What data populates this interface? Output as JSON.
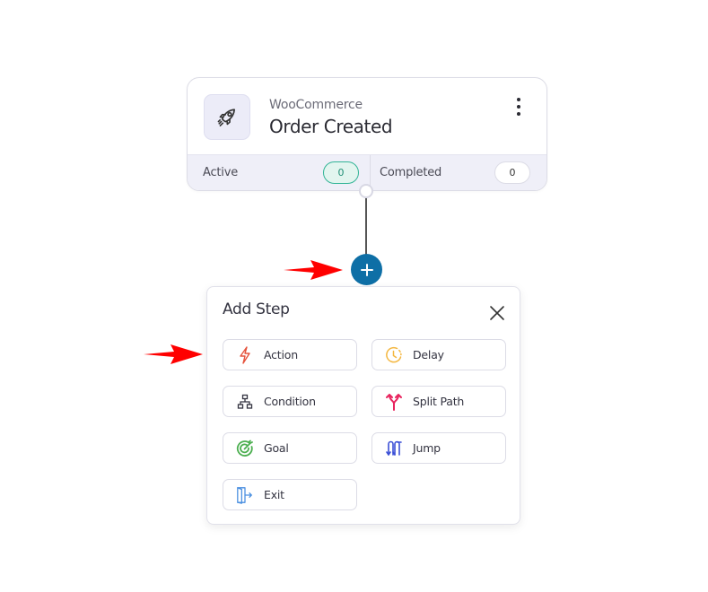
{
  "trigger": {
    "icon": "rocket-icon",
    "subtitle": "WooCommerce",
    "title": "Order Created",
    "menu_icon": "kebab-menu-icon",
    "stats": [
      {
        "label": "Active",
        "value": "0",
        "color": "#32b496"
      },
      {
        "label": "Completed",
        "value": "0"
      }
    ]
  },
  "add_button": {
    "icon": "plus-icon",
    "color": "#0e6fa6"
  },
  "add_step": {
    "title": "Add Step",
    "close_icon": "close-icon",
    "steps": [
      {
        "label": "Action",
        "icon": "lightning-icon",
        "color": "#e5533d"
      },
      {
        "label": "Delay",
        "icon": "clock-icon",
        "color": "#f4b740"
      },
      {
        "label": "Condition",
        "icon": "hierarchy-icon",
        "color": "#333340"
      },
      {
        "label": "Split Path",
        "icon": "split-arrows-icon",
        "color": "#e8245e"
      },
      {
        "label": "Goal",
        "icon": "target-icon",
        "color": "#4caf50"
      },
      {
        "label": "Jump",
        "icon": "jump-icon",
        "color": "#3b4fd6"
      },
      {
        "label": "Exit",
        "icon": "exit-door-icon",
        "color": "#4a8fe0"
      }
    ]
  },
  "annotations": {
    "arrow_color": "#ff0000"
  }
}
